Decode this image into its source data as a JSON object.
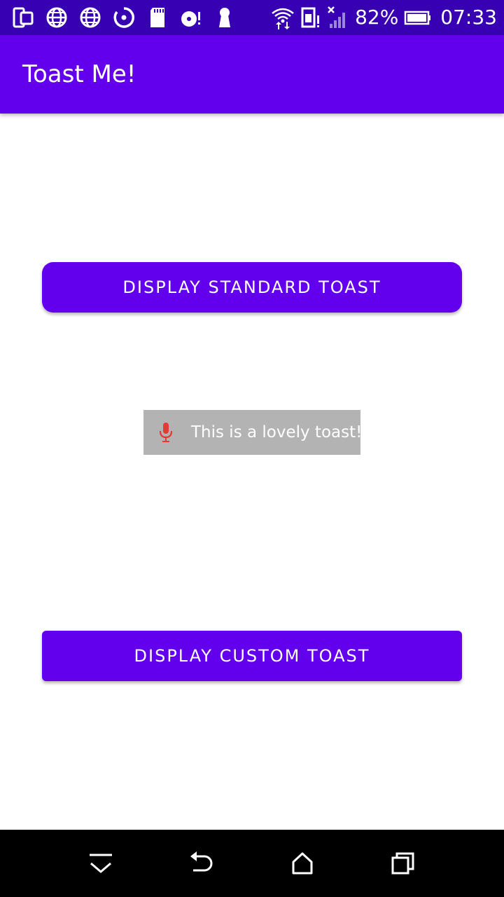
{
  "status_bar": {
    "battery_percent": "82%",
    "time": "07:33",
    "background": "#3700b3",
    "left_icons": [
      "screen-mirror-icon",
      "globe-icon",
      "globe-icon",
      "sync-icon",
      "sd-card-icon",
      "disc-alert-icon",
      "keyhole-icon"
    ],
    "right_icons": [
      "wifi-icon",
      "sim-alert-icon",
      "signal-no-service-icon",
      "battery-icon"
    ]
  },
  "app_bar": {
    "title": "Toast Me!",
    "background": "#6200ee"
  },
  "main": {
    "standard_button_label": "DISPLAY STANDARD TOAST",
    "custom_button_label": "DISPLAY CUSTOM TOAST",
    "accent": "#6200ee"
  },
  "toast": {
    "message": "This is a lovely toast!",
    "icon": "microphone-icon",
    "background": "#b3b3b3",
    "icon_color": "#e53935"
  },
  "nav_bar": {
    "buttons": [
      "hide-keyboard-icon",
      "back-icon",
      "home-icon",
      "recents-icon"
    ]
  }
}
